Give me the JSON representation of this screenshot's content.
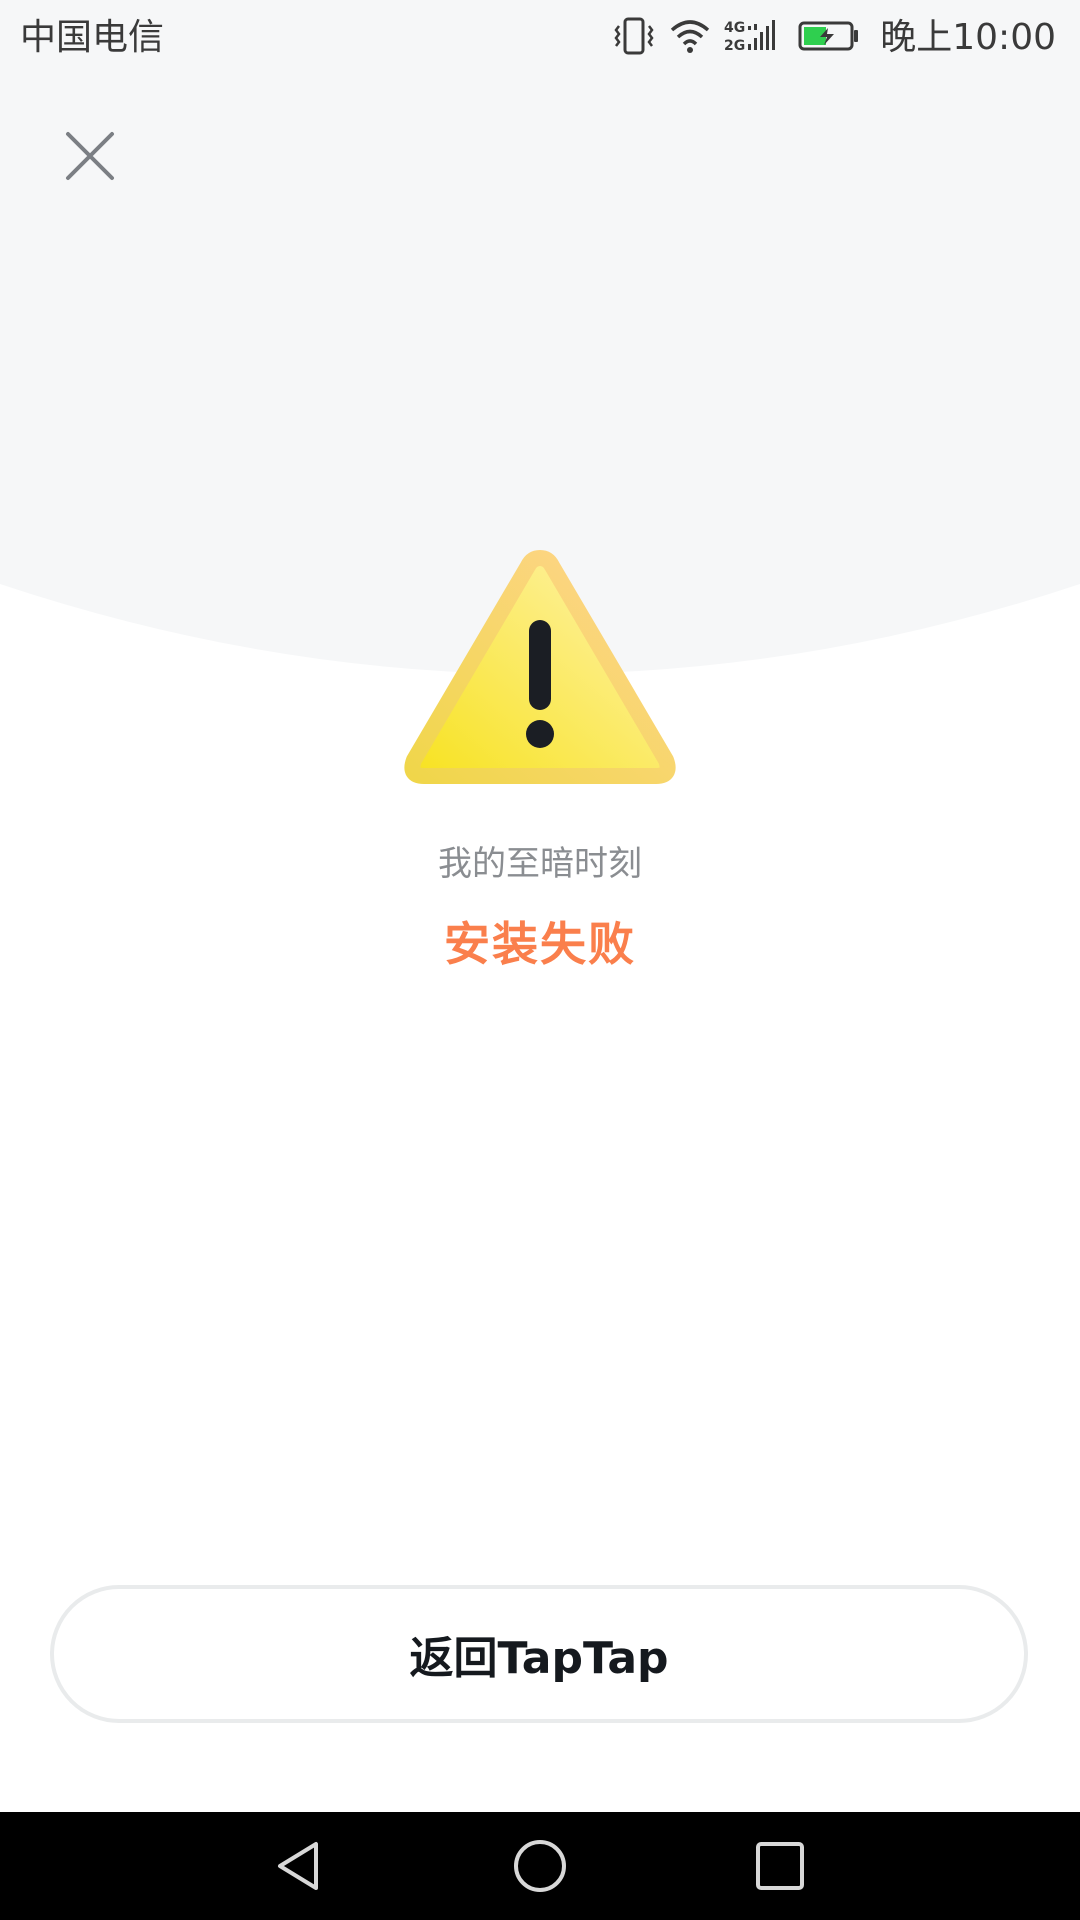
{
  "status_bar": {
    "carrier": "中国电信",
    "time": "晚上10:00",
    "icons": [
      "vibrate-icon",
      "wifi-icon",
      "signal-4g-2g-icon",
      "battery-charging-icon"
    ]
  },
  "header": {
    "close_icon": "close-icon"
  },
  "result": {
    "icon": "warning-icon",
    "game_name": "我的至暗时刻",
    "status": "安装失败"
  },
  "actions": {
    "return_label": "返回TapTap"
  },
  "nav_bar": {
    "icons": [
      "back-icon",
      "home-icon",
      "recents-icon"
    ]
  },
  "colors": {
    "header_bg": "#f6f7f8",
    "status_text": "#fa7f4c",
    "subtitle_text": "#8a8d91",
    "button_border": "#e9ebec",
    "battery_green": "#2fcf4f"
  }
}
